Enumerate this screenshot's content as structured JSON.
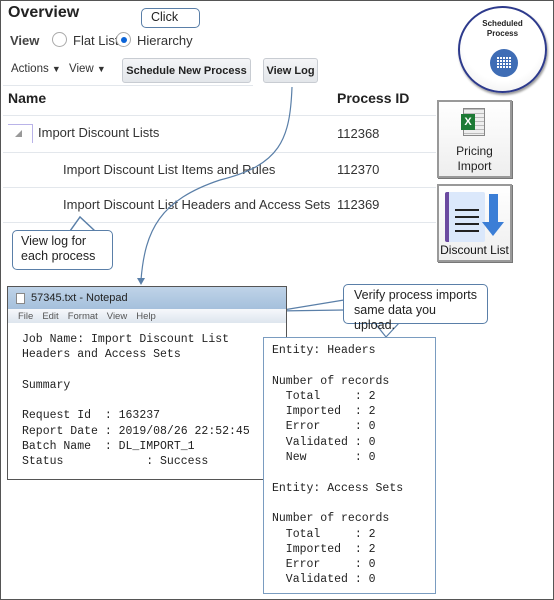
{
  "overview": {
    "title": "Overview",
    "view_label": "View",
    "flat_list": "Flat List",
    "hierarchy": "Hierarchy",
    "selected": "Hierarchy"
  },
  "callouts": {
    "click": "Click",
    "view_log_each": "View log for each process",
    "verify": "Verify process imports same data you upload."
  },
  "toolbar": {
    "actions": "Actions",
    "view": "View",
    "schedule": "Schedule New Process",
    "view_log": "View Log"
  },
  "table": {
    "headers": [
      "Name",
      "Process ID"
    ],
    "rows": [
      {
        "name": "Import Discount Lists",
        "id": "112368"
      },
      {
        "name": "Import Discount List Items and Rules",
        "id": "112370"
      },
      {
        "name": "Import Discount List Headers and Access Sets",
        "id": "112369"
      }
    ]
  },
  "tiles": {
    "scheduled": "Scheduled Process",
    "pricing_import": "Pricing Import",
    "discount_list": "Discount List"
  },
  "notepad": {
    "title": "57345.txt - Notepad",
    "menu": [
      "File",
      "Edit",
      "Format",
      "View",
      "Help"
    ],
    "text": "Job Name: Import Discount List\nHeaders and Access Sets\n\nSummary\n\nRequest Id  : 163237\nReport Date : 2019/08/26 22:52:45\nBatch Name  : DL_IMPORT_1\nStatus            : Success"
  },
  "entity_text": "Entity: Headers\n\nNumber of records\n  Total     : 2\n  Imported  : 2\n  Error     : 0\n  Validated : 0\n  New       : 0\n\nEntity: Access Sets\n\nNumber of records\n  Total     : 2\n  Imported  : 2\n  Error     : 0\n  Validated : 0",
  "colors": {
    "accent": "#0b64d8",
    "callout_border": "#5a7fa8",
    "calendar": "#3f6db5"
  }
}
